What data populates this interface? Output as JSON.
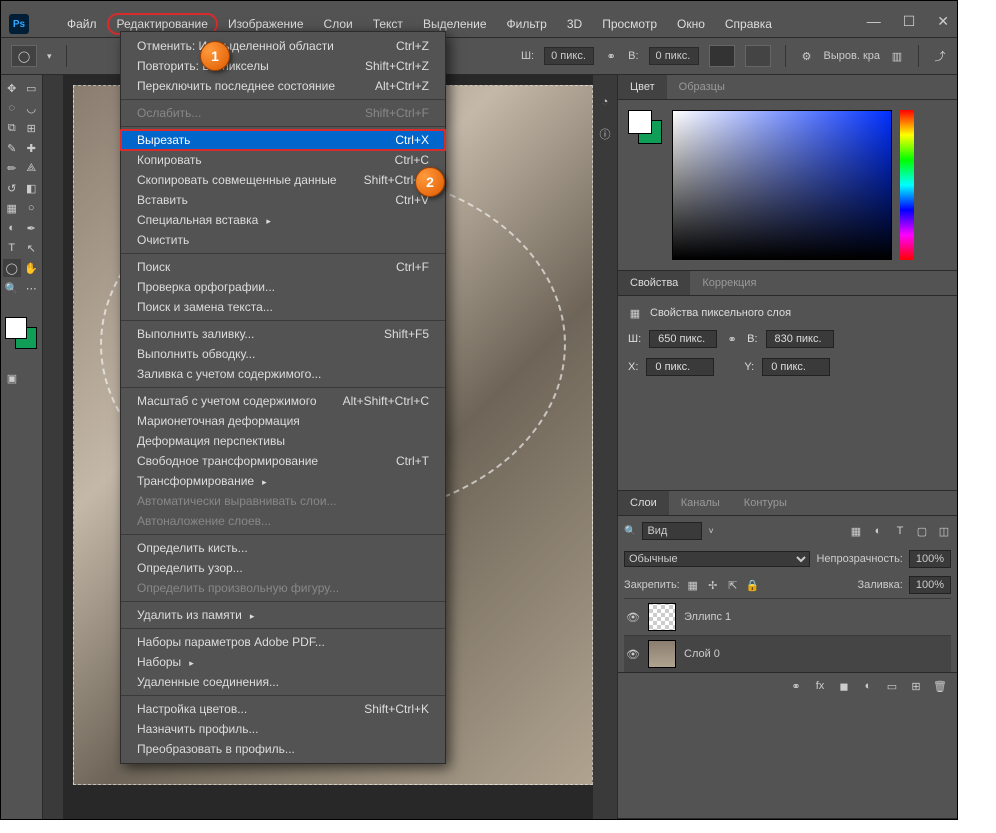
{
  "menubar": {
    "items": [
      "Файл",
      "Редактирование",
      "Изображение",
      "Слои",
      "Текст",
      "Выделение",
      "Фильтр",
      "3D",
      "Просмотр",
      "Окно",
      "Справка"
    ],
    "highlighted_index": 1
  },
  "callouts": {
    "c1": "1",
    "c2": "2"
  },
  "toolbar": {
    "w_label": "Ш:",
    "w_value": "0 пикс.",
    "h_label": "В:",
    "h_value": "0 пикс.",
    "align_label": "Выров. кра"
  },
  "dropdown": [
    {
      "label": "Отменить: Ин           выделенной области",
      "shortcut": "Ctrl+Z"
    },
    {
      "label": "Повторить: Вы        пикселы",
      "shortcut": "Shift+Ctrl+Z"
    },
    {
      "label": "Переключить последнее состояние",
      "shortcut": "Alt+Ctrl+Z"
    },
    {
      "sep": true
    },
    {
      "label": "Ослабить...",
      "shortcut": "Shift+Ctrl+F",
      "disabled": true
    },
    {
      "sep": true
    },
    {
      "label": "Вырезать",
      "shortcut": "Ctrl+X",
      "highlighted": true
    },
    {
      "label": "Копировать",
      "shortcut": "Ctrl+C"
    },
    {
      "label": "Скопировать совмещенные данные",
      "shortcut": "Shift+Ctrl+C"
    },
    {
      "label": "Вставить",
      "shortcut": "Ctrl+V"
    },
    {
      "label": "Специальная вставка",
      "arrow": true
    },
    {
      "label": "Очистить"
    },
    {
      "sep": true
    },
    {
      "label": "Поиск",
      "shortcut": "Ctrl+F"
    },
    {
      "label": "Проверка орфографии..."
    },
    {
      "label": "Поиск и замена текста..."
    },
    {
      "sep": true
    },
    {
      "label": "Выполнить заливку...",
      "shortcut": "Shift+F5"
    },
    {
      "label": "Выполнить обводку..."
    },
    {
      "label": "Заливка с учетом содержимого..."
    },
    {
      "sep": true
    },
    {
      "label": "Масштаб с учетом содержимого",
      "shortcut": "Alt+Shift+Ctrl+C"
    },
    {
      "label": "Марионеточная деформация"
    },
    {
      "label": "Деформация перспективы"
    },
    {
      "label": "Свободное трансформирование",
      "shortcut": "Ctrl+T"
    },
    {
      "label": "Трансформирование",
      "arrow": true
    },
    {
      "label": "Автоматически выравнивать слои...",
      "disabled": true
    },
    {
      "label": "Автоналожение слоев...",
      "disabled": true
    },
    {
      "sep": true
    },
    {
      "label": "Определить кисть..."
    },
    {
      "label": "Определить узор..."
    },
    {
      "label": "Определить произвольную фигуру...",
      "disabled": true
    },
    {
      "sep": true
    },
    {
      "label": "Удалить из памяти",
      "arrow": true
    },
    {
      "sep": true
    },
    {
      "label": "Наборы параметров Adobe PDF..."
    },
    {
      "label": "Наборы",
      "arrow": true
    },
    {
      "label": "Удаленные соединения..."
    },
    {
      "sep": true
    },
    {
      "label": "Настройка цветов...",
      "shortcut": "Shift+Ctrl+K"
    },
    {
      "label": "Назначить профиль..."
    },
    {
      "label": "Преобразовать в профиль..."
    }
  ],
  "panels": {
    "color": {
      "tabs": [
        "Цвет",
        "Образцы"
      ]
    },
    "properties": {
      "tabs": [
        "Свойства",
        "Коррекция"
      ],
      "title": "Свойства пиксельного слоя",
      "w_label": "Ш:",
      "w_value": "650 пикс.",
      "h_label": "В:",
      "h_value": "830 пикс.",
      "x_label": "X:",
      "x_value": "0 пикс.",
      "y_label": "Y:",
      "y_value": "0 пикс."
    },
    "layers": {
      "tabs": [
        "Слои",
        "Каналы",
        "Контуры"
      ],
      "search_placeholder": "Вид",
      "blend": "Обычные",
      "opacity_label": "Непрозрачность:",
      "opacity_value": "100%",
      "lock_label": "Закрепить:",
      "fill_label": "Заливка:",
      "fill_value": "100%",
      "items": [
        {
          "name": "Эллипс 1"
        },
        {
          "name": "Слой 0"
        }
      ]
    }
  }
}
